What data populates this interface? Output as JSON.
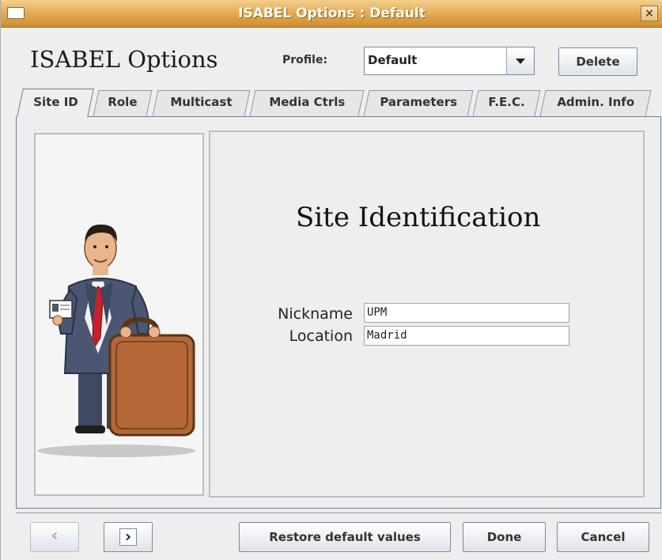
{
  "window": {
    "title": "ISABEL Options : Default",
    "close_glyph": "×"
  },
  "header": {
    "app_title": "ISABEL Options",
    "profile_label": "Profile:",
    "profile_value": "Default",
    "delete_label": "Delete"
  },
  "tabs": [
    {
      "label": "Site ID",
      "active": true
    },
    {
      "label": "Role",
      "active": false
    },
    {
      "label": "Multicast",
      "active": false
    },
    {
      "label": "Media Ctrls",
      "active": false
    },
    {
      "label": "Parameters",
      "active": false
    },
    {
      "label": "F.E.C.",
      "active": false
    },
    {
      "label": "Admin. Info",
      "active": false
    }
  ],
  "site_id": {
    "heading": "Site Identification",
    "nickname_label": "Nickname",
    "nickname_value": "UPM",
    "location_label": "Location",
    "location_value": "Madrid",
    "image_icon": "businessman-with-briefcase-illustration"
  },
  "footer": {
    "prev_glyph": "‹",
    "next_glyph": "›",
    "restore_label": "Restore default values",
    "done_label": "Done",
    "cancel_label": "Cancel"
  },
  "colors": {
    "titlebar": "#e6ae58",
    "panel_border": "#6f8094",
    "background": "#eeeeee"
  }
}
